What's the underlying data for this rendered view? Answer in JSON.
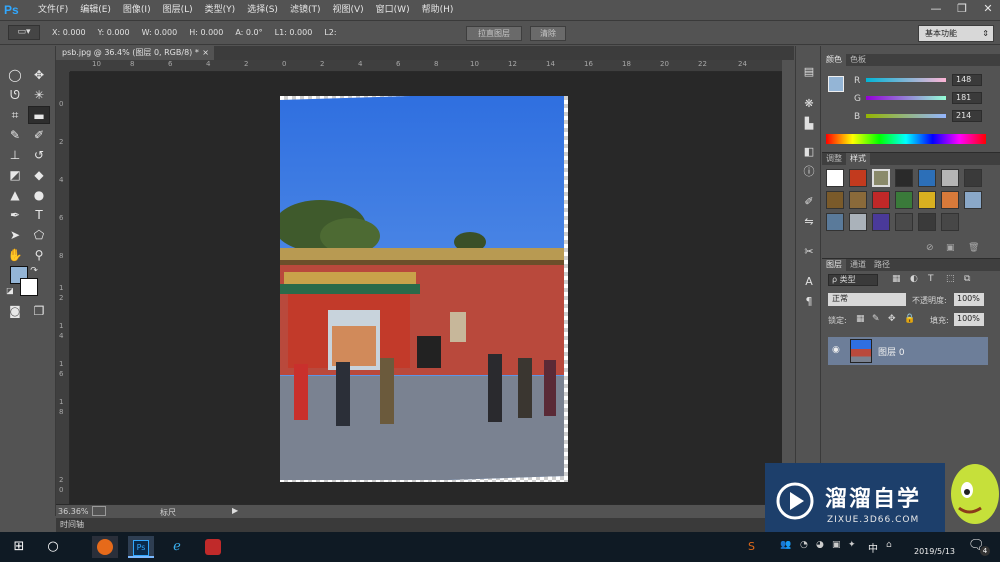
{
  "app": {
    "logo": "Ps"
  },
  "menu": [
    "文件(F)",
    "编辑(E)",
    "图像(I)",
    "图层(L)",
    "类型(Y)",
    "选择(S)",
    "滤镜(T)",
    "视图(V)",
    "窗口(W)",
    "帮助(H)"
  ],
  "window_controls": {
    "minimize": "—",
    "restore": "❐",
    "close": "✕"
  },
  "options": {
    "x": "X: 0.000",
    "y": "Y: 0.000",
    "w": "W: 0.000",
    "h": "H: 0.000",
    "a": "A: 0.0°",
    "l1": "L1: 0.000",
    "l2": "L2:",
    "straighten_label": "拉直图层",
    "clear_label": "清除",
    "workspace": "基本功能"
  },
  "document": {
    "tab_title": "psb.jpg @ 36.4% (图层 0, RGB/8) *",
    "close": "×"
  },
  "ruler_h": [
    "10",
    "8",
    "6",
    "4",
    "2",
    "0",
    "2",
    "4",
    "6",
    "8",
    "10",
    "12",
    "14",
    "16",
    "18",
    "20",
    "22",
    "24"
  ],
  "ruler_v": [
    "0",
    "2",
    "4",
    "6",
    "8",
    "1",
    "2",
    "1",
    "4",
    "1",
    "6",
    "1",
    "8",
    "2",
    "0"
  ],
  "status": {
    "zoom": "36.36%",
    "info": "标尺"
  },
  "timeline": {
    "label": "时间轴"
  },
  "color_panel": {
    "tabs": [
      "颜色",
      "色板"
    ],
    "r_label": "R",
    "g_label": "G",
    "b_label": "B",
    "r": "148",
    "g": "181",
    "b": "214",
    "fg_color": "#94b5d6"
  },
  "styles_panel": {
    "tabs": [
      "调整",
      "样式"
    ]
  },
  "layers_panel": {
    "tabs": [
      "图层",
      "通道",
      "路径"
    ],
    "filter": "ρ 类型",
    "blend_mode": "正常",
    "opacity_label": "不透明度:",
    "opacity": "100%",
    "lock_label": "锁定:",
    "fill_label": "填充:",
    "fill": "100%",
    "layer_name": "图层 0"
  },
  "taskbar": {
    "date": "2019/5/13",
    "ime": "中",
    "notification_count": "4"
  },
  "watermark": {
    "brand": "溜溜自学",
    "url": "ZIXUE.3D66.COM"
  }
}
